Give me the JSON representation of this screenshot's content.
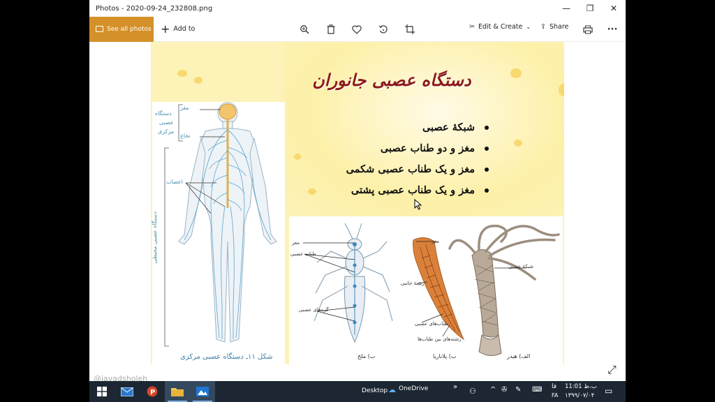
{
  "window": {
    "title": "Photos - 2020-09-24_232808.png",
    "controls": {
      "minimize": "—",
      "maximize": "❐",
      "close": "✕"
    }
  },
  "toolbar": {
    "see_all": "See all photos",
    "add_to": "Add to",
    "edit_create": "Edit & Create",
    "share": "Share",
    "more": "···",
    "icons": [
      "zoom-icon",
      "delete-icon",
      "favorite-icon",
      "rotate-icon",
      "crop-icon",
      "print-icon"
    ]
  },
  "slide": {
    "title": "دستگاه عصبی جانوران",
    "bullets": [
      "شبکهٔ عصبی",
      "مغز و دو طناب عصبی",
      "مغز و یک طناب عصبی شکمی",
      "مغز و یک طناب عصبی پشتی"
    ],
    "body_labels": {
      "brain": "مغز",
      "cns_1": "دستگاه",
      "cns_2": "عصبی",
      "cns_3": "مرکزی",
      "spinal": "نخاع",
      "nerves": "اعصاب",
      "pns": "دستگاه عصبی محیطی"
    },
    "caption": "شکل ۱۱ـ دستگاه عصبی مرکزی",
    "animal_labels": {
      "grasshopper": "ب) ملخ",
      "planaria": "ب) پلاناریا",
      "hydra": "الف) هیدر",
      "brain_g": "مغز",
      "cord_g": "طناب عصبی",
      "ganglia": "گره‌های عصبی",
      "brain_p": "مغز",
      "lateral": "رشتهٔ جانبی",
      "cords_p": "طناب‌های عصبی",
      "connect": "رشته‌های بین طناب‌ها",
      "net": "شبکهٔ عصبی"
    }
  },
  "watermark": "@javadsholeh",
  "taskbar": {
    "desktop": "Desktop",
    "onedrive": "OneDrive",
    "chevron": "»",
    "lang_1": "فا",
    "lang_2": "FA",
    "time": "ب.ظ 11:01",
    "date": "۱۳۹۹/۰۷/۰۴"
  },
  "colors": {
    "accent": "#d4912a",
    "slide_bg": "#fdf2b8",
    "title_red": "#8b1a1a",
    "nerve_blue": "#4a8fb0",
    "taskbar": "#1c2733"
  }
}
